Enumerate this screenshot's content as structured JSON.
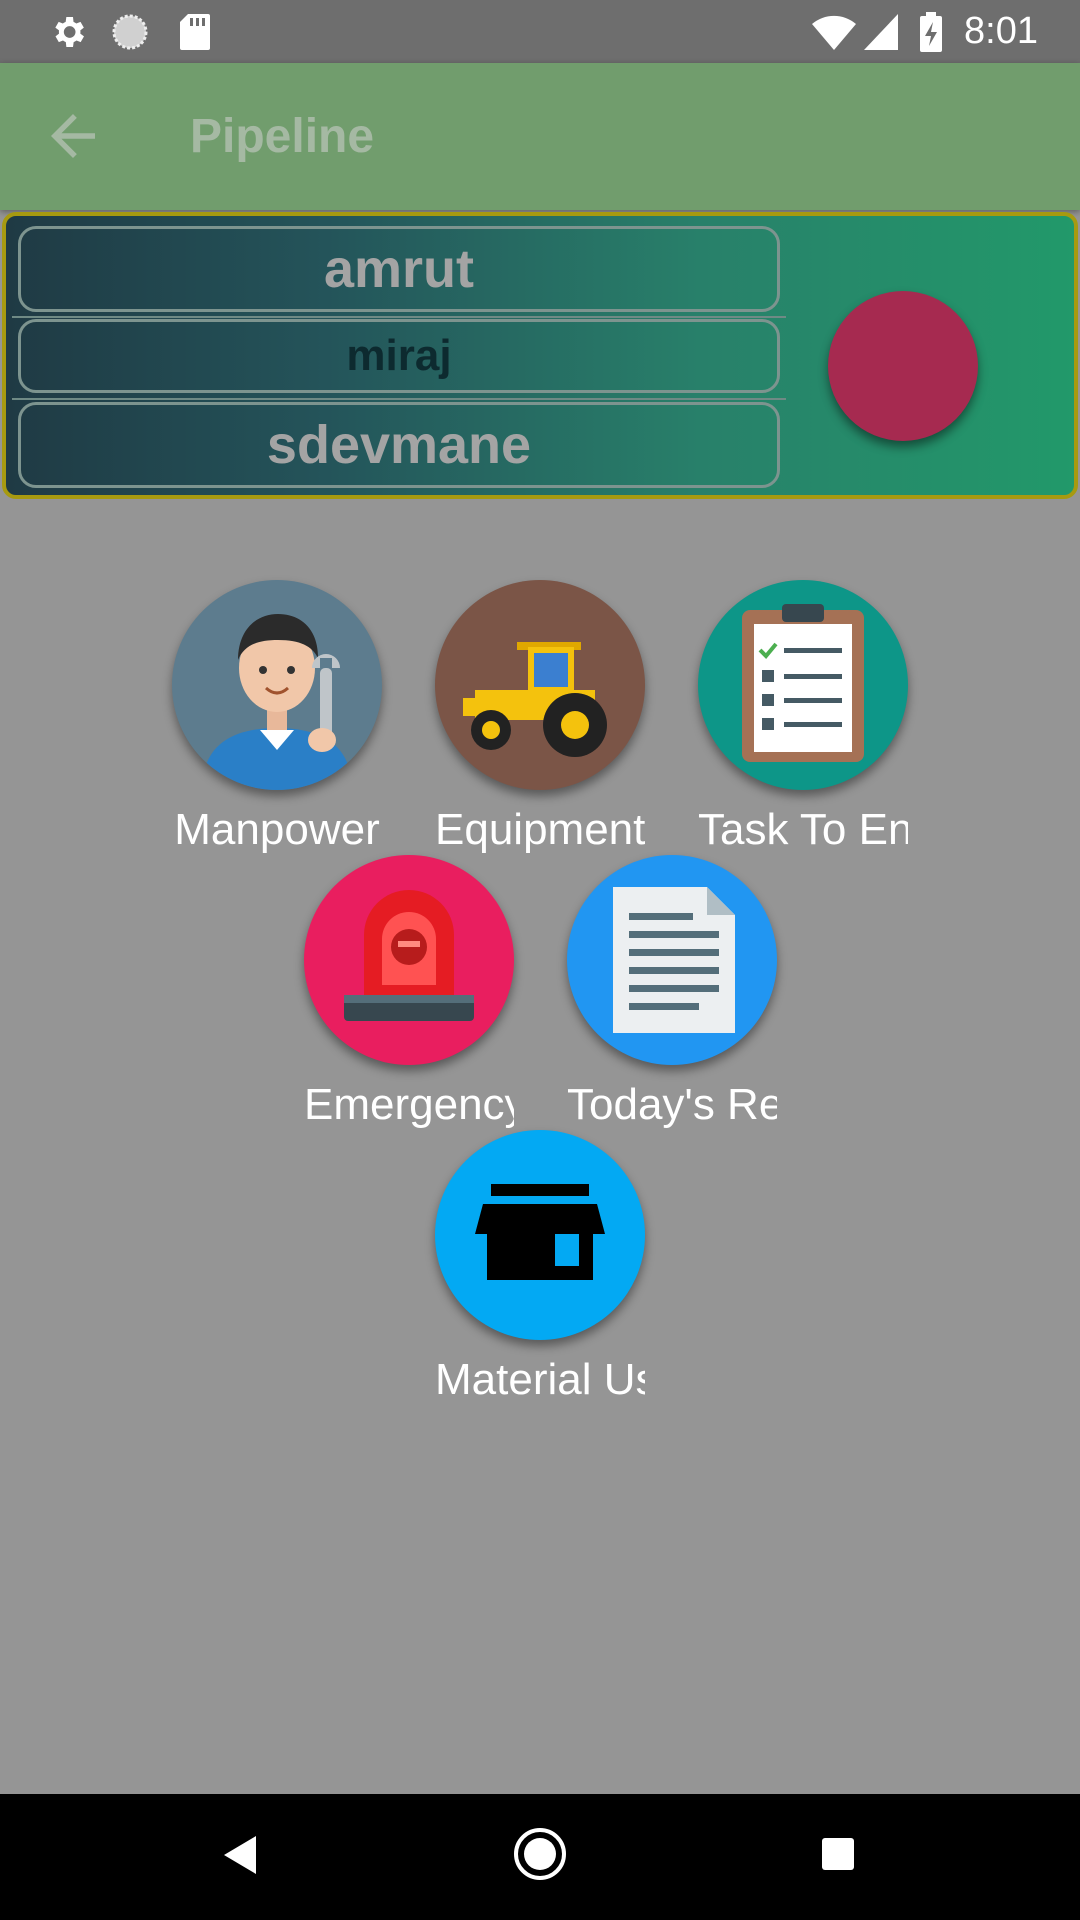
{
  "status_bar": {
    "time": "8:01"
  },
  "app_bar": {
    "title": "Pipeline"
  },
  "header": {
    "names": [
      "amrut",
      "miraj",
      "sdevmane"
    ]
  },
  "tiles": [
    {
      "label": "Manpower",
      "icon": "mechanic-icon",
      "color": "#5d7c8e"
    },
    {
      "label": "Equipment In",
      "icon": "tractor-icon",
      "color": "#7b5547"
    },
    {
      "label": "Task To End",
      "icon": "clipboard-checklist-icon",
      "color": "#0d9688"
    },
    {
      "label": "Emergency Request",
      "icon": "siren-icon",
      "color": "#e91e5f"
    },
    {
      "label": "Today's Report",
      "icon": "document-icon",
      "color": "#2196f2"
    },
    {
      "label": "Material Used",
      "icon": "store-icon",
      "color": "#03a9f3"
    }
  ]
}
